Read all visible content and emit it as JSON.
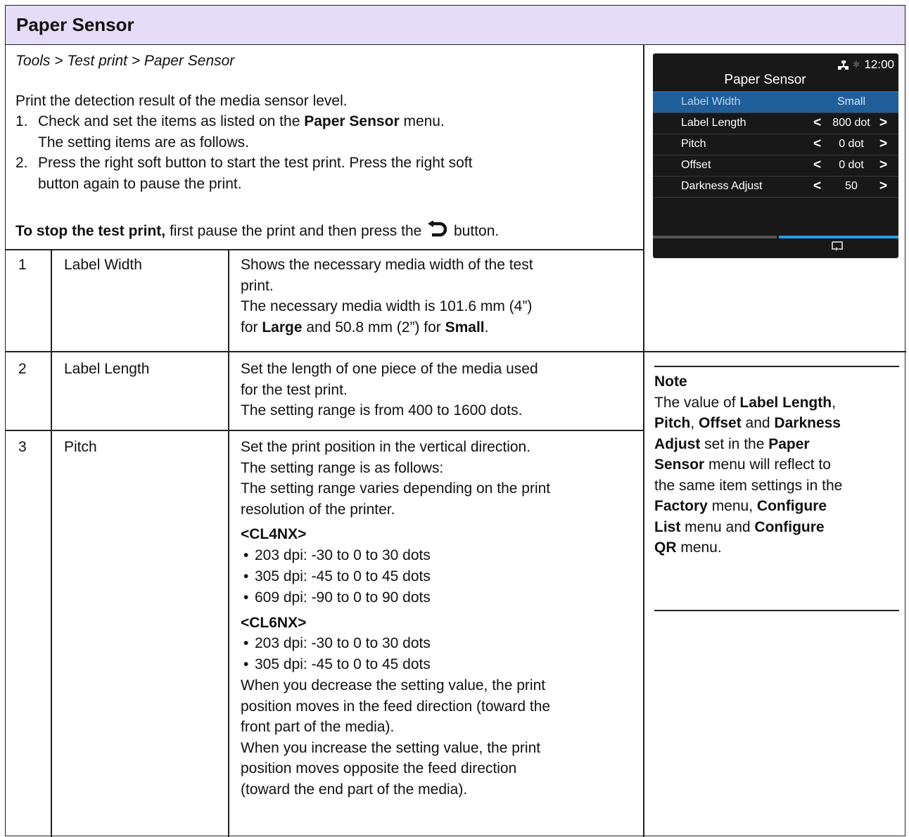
{
  "header": {
    "title": "Paper Sensor"
  },
  "breadcrumb": "Tools > Test print > Paper Sensor",
  "intro": "Print the detection result of the media sensor level.",
  "steps": [
    {
      "num": "1.",
      "pre": "Check and set the items as listed on the ",
      "bold": "Paper Sensor",
      "post": " menu.",
      "line2": "The setting items are as follows."
    },
    {
      "num": "2.",
      "text": "Press the right soft button to start the test print. Press the right soft",
      "line2": "button again to pause the print."
    }
  ],
  "stop": {
    "bold": "To stop the test print,",
    "text": " first pause the print and then press the ",
    "after": " button.",
    "icon": "return-icon"
  },
  "lcd": {
    "time": "12:00",
    "title": "Paper Sensor",
    "rows": [
      {
        "label": "Label Width",
        "value": "Small"
      },
      {
        "label": "Label Length",
        "value": "800 dot"
      },
      {
        "label": "Pitch",
        "value": "0 dot"
      },
      {
        "label": "Offset",
        "value": "0 dot"
      },
      {
        "label": "Darkness Adjust",
        "value": "50"
      }
    ],
    "soft_right_icon": "test-print-icon"
  },
  "table": [
    {
      "num": "1",
      "name": "Label Width",
      "l1": "Shows the necessary media width of the test",
      "l2": "print.",
      "l3": "The necessary media width is 101.6 mm (4”)",
      "l4a": "for ",
      "l4b": "Large",
      "l4c": " and 50.8 mm (2”) for ",
      "l4d": "Small",
      "l4e": "."
    },
    {
      "num": "2",
      "name": "Label Length",
      "l1": "Set the length of one piece of the media used",
      "l2": "for the test print.",
      "l3": "The setting range is from 400 to 1600 dots."
    },
    {
      "num": "3",
      "name": "Pitch",
      "l1": "Set the print position in the vertical direction.",
      "l2": "The setting range is as follows:",
      "l3": "The setting range varies depending on the print",
      "l4": "resolution of the printer.",
      "cl4": "<CL4NX>",
      "cl4_items": [
        "203 dpi: -30 to 0 to 30 dots",
        "305 dpi: -45 to 0 to 45 dots",
        "609 dpi: -90 to 0 to 90 dots"
      ],
      "cl6": "<CL6NX>",
      "cl6_items": [
        "203 dpi: -30 to 0 to 30 dots",
        "305 dpi: -45 to 0 to 45 dots"
      ],
      "tail": [
        "When you decrease the setting value, the print",
        "position moves in the feed direction (toward the",
        "front part of the media).",
        "When you increase the setting value, the print",
        "position moves opposite the feed direction",
        "(toward the end part of the media)."
      ]
    }
  ],
  "note": {
    "heading": "Note",
    "t1": "The value of ",
    "b1": "Label Length",
    "t2": ",",
    "b2": "Pitch",
    "t3": ", ",
    "b3": "Offset",
    "t4": " and ",
    "b4": "Darkness",
    "b5": "Adjust",
    "t5": " set in the ",
    "b6": "Paper",
    "b7": "Sensor",
    "t6": " menu will reflect to",
    "t7": "the same item settings in the",
    "b8": "Factory",
    "t8": " menu, ",
    "b9": "Configure",
    "b10": "List",
    "t9": " menu and ",
    "b11": "Configure",
    "b12": "QR",
    "t10": " menu."
  }
}
